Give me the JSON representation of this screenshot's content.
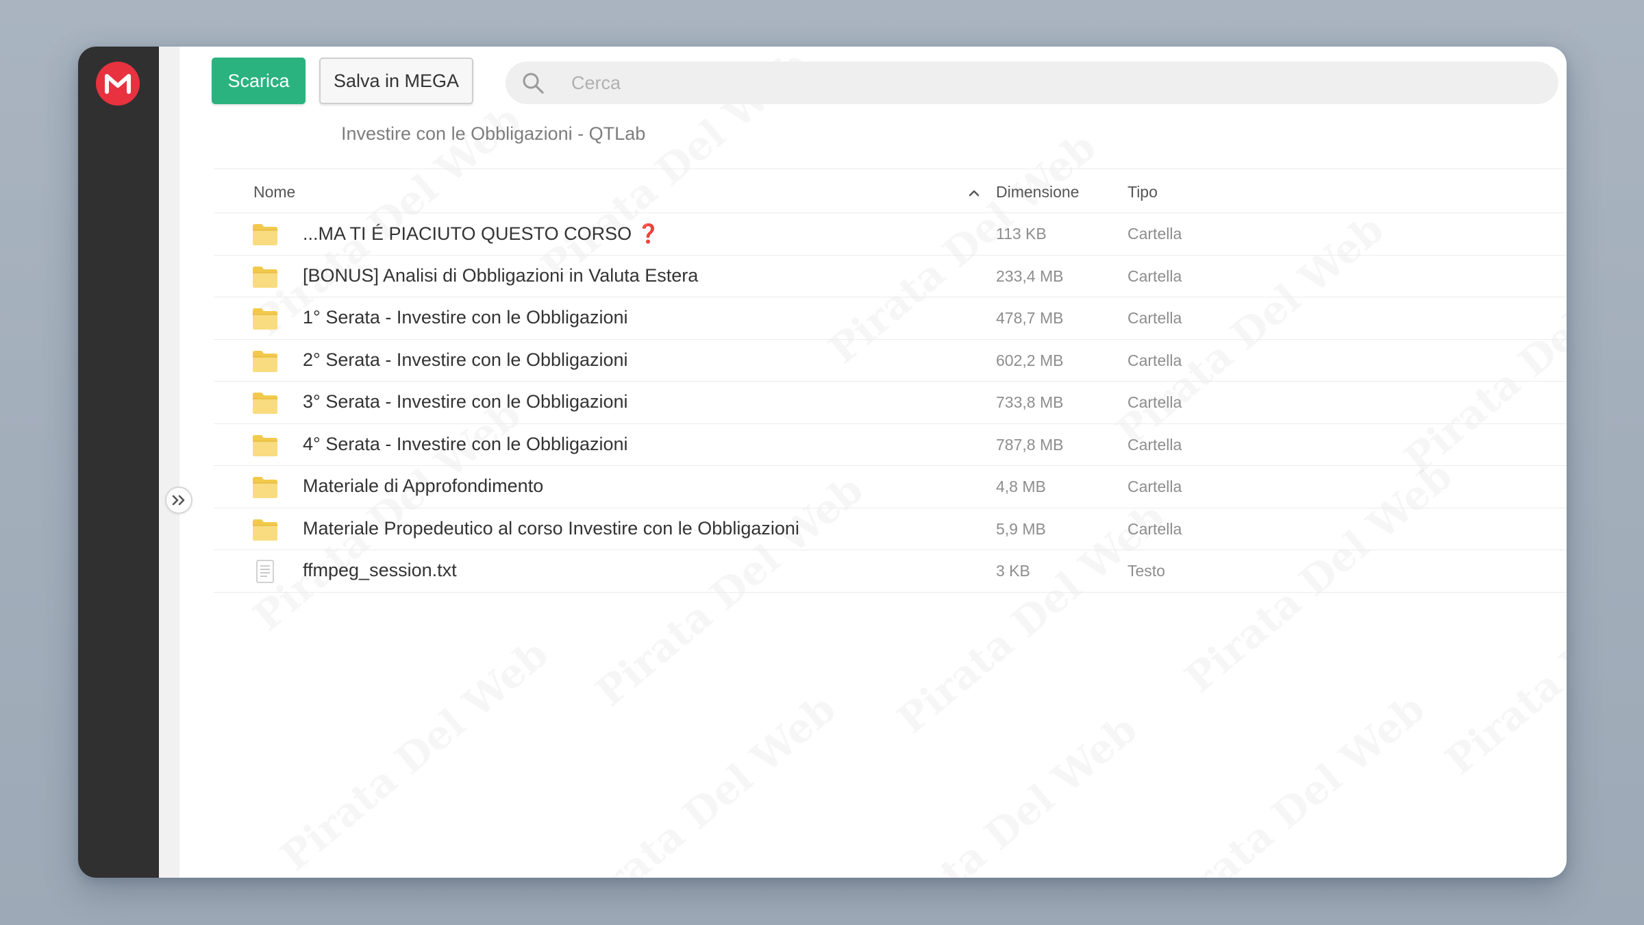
{
  "app": {
    "logo_letter": "M"
  },
  "toolbar": {
    "download_label": "Scarica",
    "save_label": "Salva in MEGA"
  },
  "search": {
    "placeholder": "Cerca"
  },
  "breadcrumb": "Investire con le Obbligazioni - QTLab",
  "columns": {
    "name": "Nome",
    "size": "Dimensione",
    "type": "Tipo"
  },
  "watermark_text": "Pirata Del Web",
  "files": [
    {
      "name": "...MA TI É PIACIUTO QUESTO CORSO",
      "suffix": "❓",
      "size": "113 KB",
      "type": "Cartella",
      "icon": "folder-icon"
    },
    {
      "name": "[BONUS] Analisi di Obbligazioni in Valuta Estera",
      "suffix": "",
      "size": "233,4 MB",
      "type": "Cartella",
      "icon": "folder-icon"
    },
    {
      "name": "1° Serata - Investire con le Obbligazioni",
      "suffix": "",
      "size": "478,7 MB",
      "type": "Cartella",
      "icon": "folder-icon"
    },
    {
      "name": "2° Serata - Investire con le Obbligazioni",
      "suffix": "",
      "size": "602,2 MB",
      "type": "Cartella",
      "icon": "folder-icon"
    },
    {
      "name": "3° Serata - Investire con le Obbligazioni",
      "suffix": "",
      "size": "733,8 MB",
      "type": "Cartella",
      "icon": "folder-icon"
    },
    {
      "name": "4° Serata - Investire con le Obbligazioni",
      "suffix": "",
      "size": "787,8 MB",
      "type": "Cartella",
      "icon": "folder-icon"
    },
    {
      "name": "Materiale di Approfondimento",
      "suffix": "",
      "size": "4,8 MB",
      "type": "Cartella",
      "icon": "folder-icon"
    },
    {
      "name": "Materiale Propedeutico al corso Investire con le Obbligazioni",
      "suffix": "",
      "size": "5,9 MB",
      "type": "Cartella",
      "icon": "folder-icon"
    },
    {
      "name": "ffmpeg_session.txt",
      "suffix": "",
      "size": "3 KB",
      "type": "Testo",
      "icon": "text-file-icon"
    }
  ],
  "colors": {
    "accent_green": "#2bb37f",
    "mega_red": "#e8323f",
    "sidebar": "#303030",
    "folder": "#f7d26a"
  }
}
